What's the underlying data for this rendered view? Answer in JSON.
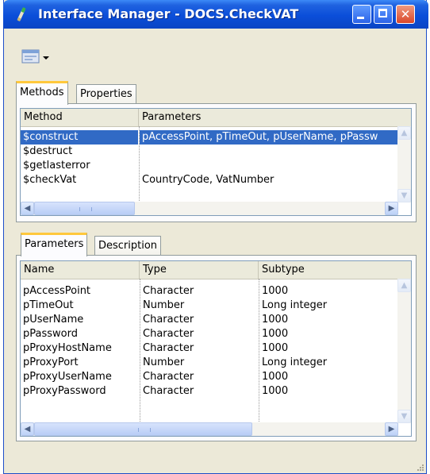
{
  "window": {
    "title": "Interface Manager - DOCS.CheckVAT",
    "icons": [
      "script-icon",
      "minimize-icon",
      "maximize-icon",
      "close-icon"
    ]
  },
  "toolbar": {
    "icon": "view-dropdown-icon"
  },
  "top_tabs": [
    "Methods",
    "Properties"
  ],
  "methods": {
    "columns": [
      "Method",
      "Parameters"
    ],
    "rows": [
      {
        "method": "$construct",
        "params": "pAccessPoint, pTimeOut, pUserName, pPassw"
      },
      {
        "method": "$destruct",
        "params": ""
      },
      {
        "method": "$getlasterror",
        "params": ""
      },
      {
        "method": "$checkVat",
        "params": "CountryCode, VatNumber"
      }
    ],
    "selected_index": 0
  },
  "bottom_tabs": [
    "Parameters",
    "Description"
  ],
  "parameters": {
    "columns": [
      "Name",
      "Type",
      "Subtype"
    ],
    "rows": [
      {
        "name": "pAccessPoint",
        "type": "Character",
        "subtype": "1000"
      },
      {
        "name": "pTimeOut",
        "type": "Number",
        "subtype": "Long integer"
      },
      {
        "name": "pUserName",
        "type": "Character",
        "subtype": "1000"
      },
      {
        "name": "pPassword",
        "type": "Character",
        "subtype": "1000"
      },
      {
        "name": "pProxyHostName",
        "type": "Character",
        "subtype": "1000"
      },
      {
        "name": "pProxyPort",
        "type": "Number",
        "subtype": "Long integer"
      },
      {
        "name": "pProxyUserName",
        "type": "Character",
        "subtype": "1000"
      },
      {
        "name": "pProxyPassword",
        "type": "Character",
        "subtype": "1000"
      }
    ]
  },
  "colors": {
    "title_bar": "#0a4fd9",
    "selection": "#316ac5",
    "tab_highlight": "#ffc83c",
    "window_bg": "#ece9d8"
  }
}
